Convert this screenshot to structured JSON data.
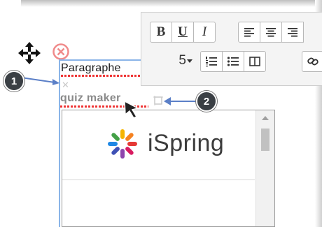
{
  "editor": {
    "paragraph_text": "Paragraphe",
    "link_text": "quiz maker"
  },
  "toolbar": {
    "bold_label": "B",
    "underline_label": "U",
    "italic_label": "I",
    "font_size_value": "5",
    "buttons": [
      "align-left-icon",
      "align-center-icon",
      "align-right-icon",
      "ordered-list-icon",
      "unordered-list-icon",
      "block-icon",
      "link-icon"
    ]
  },
  "embed": {
    "logo_text": "iSpring"
  },
  "annotations": {
    "callout_1": "1",
    "callout_2": "2"
  },
  "colors": {
    "selection": "#8ab4e8",
    "callout_bg": "#3a3f44",
    "delete_icon": "#f08a8a",
    "spell_underline": "#e33333"
  }
}
